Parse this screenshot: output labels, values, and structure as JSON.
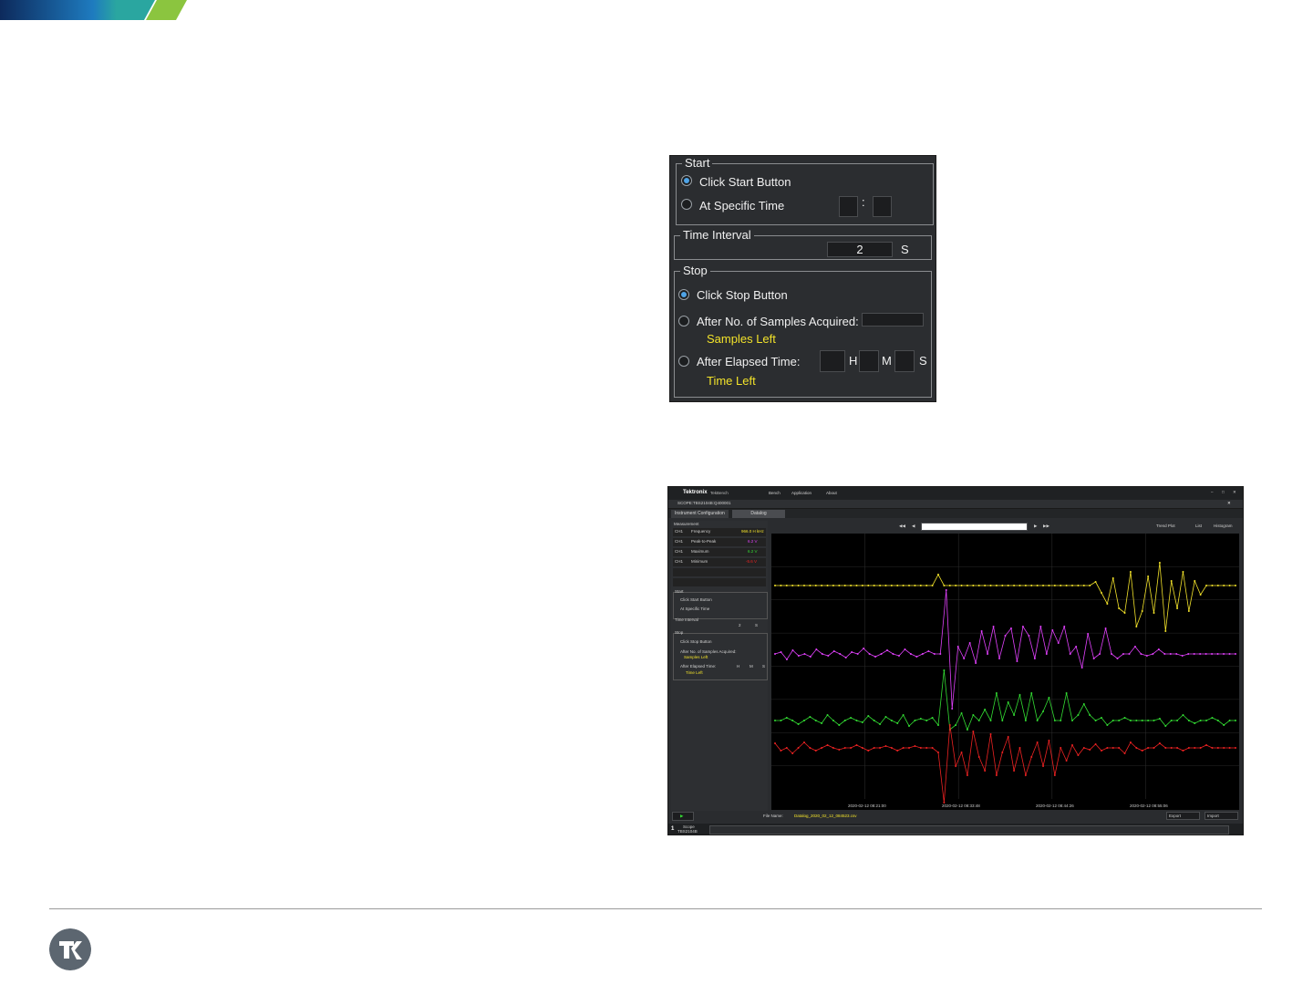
{
  "start": {
    "title": "Start",
    "click_start": "Click Start Button",
    "at_specific_time": "At Specific Time",
    "time_separator": ":"
  },
  "interval": {
    "title": "Time Interval",
    "value": "2",
    "unit": "S"
  },
  "stop": {
    "title": "Stop",
    "click_stop": "Click Stop Button",
    "after_samples": "After No. of Samples Acquired:",
    "samples_left": "Samples Left",
    "after_elapsed": "After Elapsed Time:",
    "h": "H",
    "m": "M",
    "s": "S",
    "time_left": "Time Left"
  },
  "app": {
    "brand": "Tektronix",
    "product": "TekBench",
    "menu": [
      "Bench",
      "Application",
      "About"
    ],
    "instrument": "SCOPE:TBS2104B:Q400001",
    "tabs": [
      "Instrument Configuration",
      "Datalog"
    ],
    "measurement_title": "Measurement",
    "measurements": [
      {
        "ch": "CH1",
        "name": "Frequency",
        "value": "966.0 H kHz",
        "color": "#f2e22a"
      },
      {
        "ch": "CH1",
        "name": "Peak-to-Peak",
        "value": "6.2 V",
        "color": "#e040fb"
      },
      {
        "ch": "CH1",
        "name": "Maximum",
        "value": "6.2 V",
        "color": "#33dd33"
      },
      {
        "ch": "CH1",
        "name": "Minimum",
        "value": "-5.6 V",
        "color": "#ee2222"
      }
    ],
    "mini_start": "Start",
    "mini_click_start": "Click Start Button",
    "mini_at_time": "At Specific Time",
    "mini_interval": "Time Interval",
    "mini_interval_value": "2",
    "mini_interval_unit": "S",
    "mini_stop": "Stop",
    "mini_click_stop": "Click Stop Button",
    "mini_after_samples": "After No. of Samples Acquired:",
    "mini_samples_left": "Samples Left",
    "mini_after_elapsed": "After Elapsed Time:",
    "mini_h": "H",
    "mini_m": "M",
    "mini_s": "S",
    "mini_time_left": "Time Left",
    "view_buttons": [
      "Trend Plot",
      "List",
      "Histogram"
    ],
    "x_ticks": [
      "2020-02-12 08:21:00",
      "2020-02-12 08:33:48",
      "2020-02-12 08:44:26",
      "2020-02-12 08:55:06"
    ],
    "file_label": "File Name:",
    "file_name": "Datalog_2020_02_12_084523.csv",
    "export": "Export",
    "import": "Import",
    "instrument_slot": "1",
    "scope_label": "Scope",
    "scope_model": "TBS2104B"
  },
  "colors": {
    "yellow": "#f2e22a",
    "magenta": "#e040fb",
    "green": "#33dd33",
    "red": "#ee2222",
    "accent": "#4fa3e6"
  },
  "icons": [
    "radio-selected",
    "radio-empty",
    "play-icon",
    "close-icon",
    "minimize-icon",
    "maximize-icon"
  ]
}
